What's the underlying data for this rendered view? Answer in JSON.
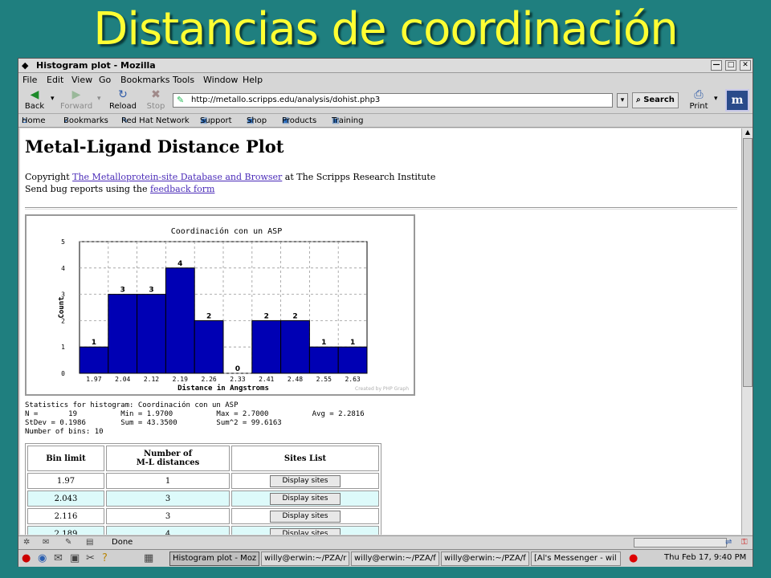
{
  "slide": {
    "title": "Distancias de coordinación"
  },
  "window": {
    "title": "Histogram plot - Mozilla",
    "controls": {
      "minimize": "—",
      "maximize": "□",
      "close": "✕"
    }
  },
  "menu": [
    "File",
    "Edit",
    "View",
    "Go",
    "Bookmarks",
    "Tools",
    "Window",
    "Help"
  ],
  "toolbar": {
    "back": "Back",
    "forward": "Forward",
    "reload": "Reload",
    "stop": "Stop",
    "url": "http://metallo.scripps.edu/analysis/dohist.php3",
    "search": "Search",
    "print": "Print"
  },
  "bookmarks": [
    "Home",
    "Bookmarks",
    "Red Hat Network",
    "Support",
    "Shop",
    "Products",
    "Training"
  ],
  "page": {
    "heading": "Metal-Ligand Distance Plot",
    "copyright_prefix": "Copyright ",
    "copyright_link": "The Metalloprotein-site Database and Browser",
    "copyright_suffix": " at The Scripps Research Institute",
    "bug_prefix": "Send bug reports using the ",
    "bug_link": "feedback form"
  },
  "chart_data": {
    "type": "bar",
    "title": "Coordinación con un ASP",
    "xlabel": "Distance in Angstroms",
    "ylabel": "Count",
    "categories": [
      "1.97",
      "2.04",
      "2.12",
      "2.19",
      "2.26",
      "2.33",
      "2.41",
      "2.48",
      "2.55",
      "2.63"
    ],
    "values": [
      1,
      3,
      3,
      4,
      2,
      0,
      2,
      2,
      1,
      1
    ],
    "ylim": [
      0,
      5
    ],
    "yticks": [
      "0",
      "1",
      "2",
      "3",
      "4",
      "5"
    ],
    "grid": true,
    "bar_color": "#0000b4",
    "credit": "Created by PHP Graph"
  },
  "stats": {
    "line1": "Statistics for histogram: Coordinación con un ASP",
    "line2": "N =       19          Min = 1.9700          Max = 2.7000          Avg = 2.2816",
    "line3": "StDev = 0.1986        Sum = 43.3500         Sum^2 = 99.6163",
    "line4": "Number of bins: 10"
  },
  "table": {
    "headers": [
      "Bin limit",
      "Number of\nM-L distances",
      "Sites List"
    ],
    "button_label": "Display sites",
    "rows": [
      {
        "limit": "1.97",
        "count": "1"
      },
      {
        "limit": "2.043",
        "count": "3"
      },
      {
        "limit": "2.116",
        "count": "3"
      },
      {
        "limit": "2.189",
        "count": "4"
      }
    ]
  },
  "status": {
    "text": "Done"
  },
  "taskbar": {
    "items": [
      "Histogram plot - Moz",
      "willy@erwin:~/PZA/r",
      "willy@erwin:~/PZA/f",
      "willy@erwin:~/PZA/f",
      "[Al's Messenger - wil"
    ],
    "clock": "Thu Feb 17,  9:40 PM"
  }
}
